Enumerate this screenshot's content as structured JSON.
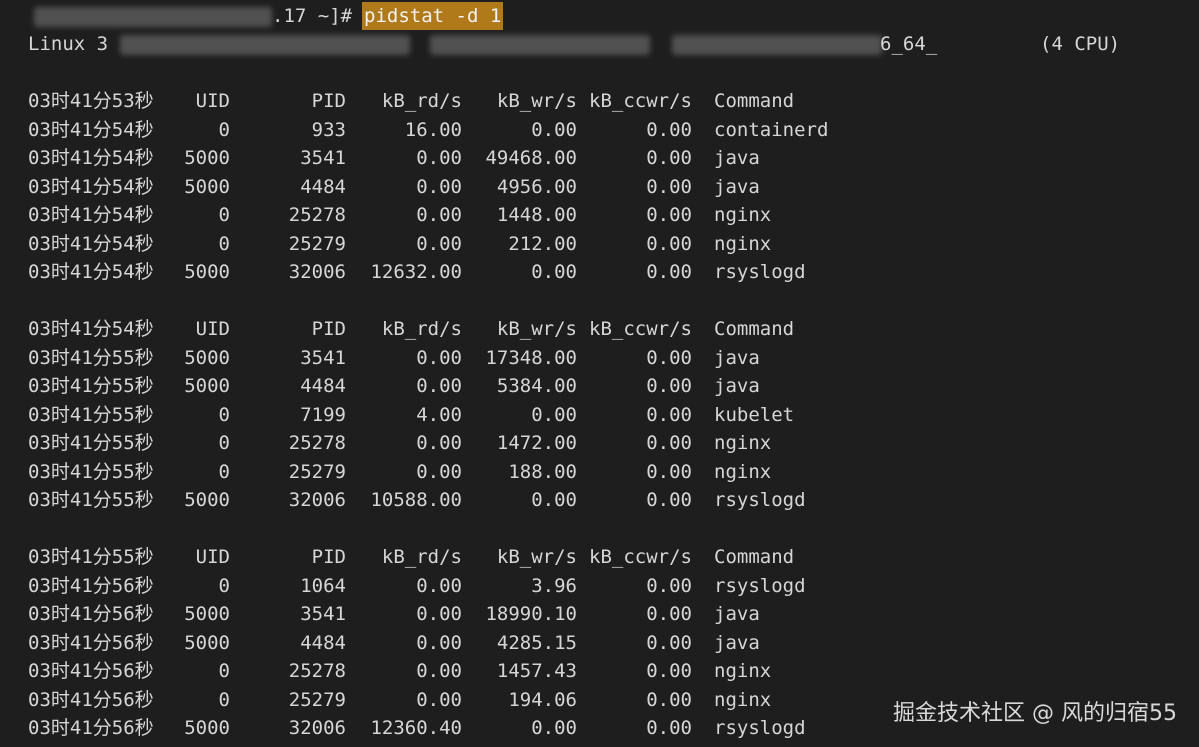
{
  "prompt": {
    "fragment": ".17 ~]# ",
    "command": "pidstat -d 1"
  },
  "sysinfo": {
    "os": "Linux 3",
    "arch_fragment": "6_64_",
    "cpu": "(4 CPU)"
  },
  "blocks": [
    {
      "header": [
        "03时41分53秒",
        "UID",
        "PID",
        "kB_rd/s",
        "kB_wr/s",
        "kB_ccwr/s",
        "Command"
      ],
      "rows": [
        [
          "03时41分54秒",
          "0",
          "933",
          "16.00",
          "0.00",
          "0.00",
          "containerd"
        ],
        [
          "03时41分54秒",
          "5000",
          "3541",
          "0.00",
          "49468.00",
          "0.00",
          "java"
        ],
        [
          "03时41分54秒",
          "5000",
          "4484",
          "0.00",
          "4956.00",
          "0.00",
          "java"
        ],
        [
          "03时41分54秒",
          "0",
          "25278",
          "0.00",
          "1448.00",
          "0.00",
          "nginx"
        ],
        [
          "03时41分54秒",
          "0",
          "25279",
          "0.00",
          "212.00",
          "0.00",
          "nginx"
        ],
        [
          "03时41分54秒",
          "5000",
          "32006",
          "12632.00",
          "0.00",
          "0.00",
          "rsyslogd"
        ]
      ]
    },
    {
      "header": [
        "03时41分54秒",
        "UID",
        "PID",
        "kB_rd/s",
        "kB_wr/s",
        "kB_ccwr/s",
        "Command"
      ],
      "rows": [
        [
          "03时41分55秒",
          "5000",
          "3541",
          "0.00",
          "17348.00",
          "0.00",
          "java"
        ],
        [
          "03时41分55秒",
          "5000",
          "4484",
          "0.00",
          "5384.00",
          "0.00",
          "java"
        ],
        [
          "03时41分55秒",
          "0",
          "7199",
          "4.00",
          "0.00",
          "0.00",
          "kubelet"
        ],
        [
          "03时41分55秒",
          "0",
          "25278",
          "0.00",
          "1472.00",
          "0.00",
          "nginx"
        ],
        [
          "03时41分55秒",
          "0",
          "25279",
          "0.00",
          "188.00",
          "0.00",
          "nginx"
        ],
        [
          "03时41分55秒",
          "5000",
          "32006",
          "10588.00",
          "0.00",
          "0.00",
          "rsyslogd"
        ]
      ]
    },
    {
      "header": [
        "03时41分55秒",
        "UID",
        "PID",
        "kB_rd/s",
        "kB_wr/s",
        "kB_ccwr/s",
        "Command"
      ],
      "rows": [
        [
          "03时41分56秒",
          "0",
          "1064",
          "0.00",
          "3.96",
          "0.00",
          "rsyslogd"
        ],
        [
          "03时41分56秒",
          "5000",
          "3541",
          "0.00",
          "18990.10",
          "0.00",
          "java"
        ],
        [
          "03时41分56秒",
          "5000",
          "4484",
          "0.00",
          "4285.15",
          "0.00",
          "java"
        ],
        [
          "03时41分56秒",
          "0",
          "25278",
          "0.00",
          "1457.43",
          "0.00",
          "nginx"
        ],
        [
          "03时41分56秒",
          "0",
          "25279",
          "0.00",
          "194.06",
          "0.00",
          "nginx"
        ],
        [
          "03时41分56秒",
          "5000",
          "32006",
          "12360.40",
          "0.00",
          "0.00",
          "rsyslogd"
        ]
      ]
    }
  ],
  "watermark": "掘金技术社区 @ 风的归宿55",
  "colors": {
    "background": "#1e1e1e",
    "foreground": "#d6d6d6",
    "command_highlight": "#b07a1a"
  }
}
